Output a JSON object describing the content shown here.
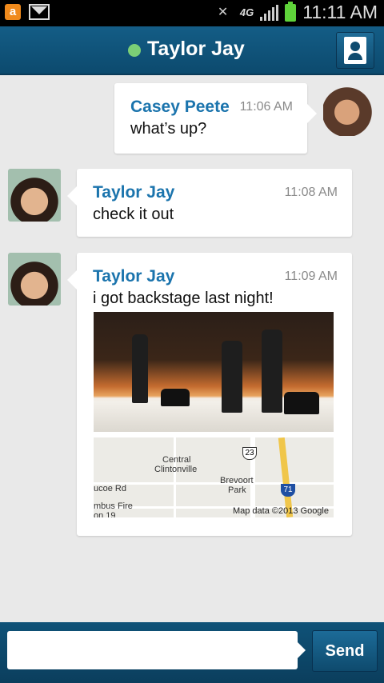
{
  "status_bar": {
    "time": "11:11 AM",
    "network": "4G"
  },
  "header": {
    "contact_name": "Taylor Jay"
  },
  "messages": [
    {
      "sender": "Casey Peete",
      "time": "11:06 AM",
      "text": "what’s up?"
    },
    {
      "sender": "Taylor Jay",
      "time": "11:08 AM",
      "text": "check it out"
    },
    {
      "sender": "Taylor Jay",
      "time": "11:09 AM",
      "text": "i got backstage last night!"
    }
  ],
  "map": {
    "labels": [
      "Central",
      "Clintonville",
      "Brevoort",
      "Park",
      "ucoe Rd",
      "mbus Fire",
      "on 19"
    ],
    "route_23": "23",
    "route_71": "71",
    "credit": "Map data ©2013 Google"
  },
  "composer": {
    "placeholder": "",
    "send_label": "Send"
  },
  "colors": {
    "header": "#145d86",
    "name": "#1b74ad",
    "online": "#7bcf76"
  }
}
